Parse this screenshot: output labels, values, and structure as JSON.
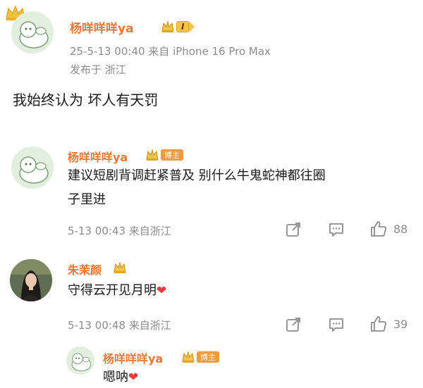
{
  "post": {
    "author": "杨咩咩咩ya",
    "level": "I",
    "meta": "25-5-13 00:40  来自 iPhone 16 Pro Max",
    "location": "发布于 浙江",
    "text": "我始终认为 坏人有天罚"
  },
  "comments": [
    {
      "author": "杨咩咩咩ya",
      "badge": "博主",
      "text_line1": "建议短剧背调赶紧普及 别什么牛鬼蛇神都往圈",
      "text_line2": "子里进",
      "meta": "5-13 00:43 来自浙江",
      "likes": "88"
    },
    {
      "author": "朱茉颜",
      "text": "守得云开见月明",
      "heart": "❤",
      "meta": "5-13 00:48 来自浙江",
      "likes": "39"
    }
  ],
  "reply": {
    "author": "杨咩咩咩ya",
    "badge": "博主",
    "text": "嗯呐",
    "heart": "❤"
  },
  "colors": {
    "name": "#e5793a",
    "meta": "#8c8c8c",
    "heart": "#e83c3c",
    "badge_gold": "#f5c24a",
    "badge_orange": "#f39a3a"
  },
  "icons": [
    "crown-icon",
    "vip-crown-icon",
    "share-icon",
    "comment-icon",
    "like-icon",
    "heart-icon"
  ]
}
